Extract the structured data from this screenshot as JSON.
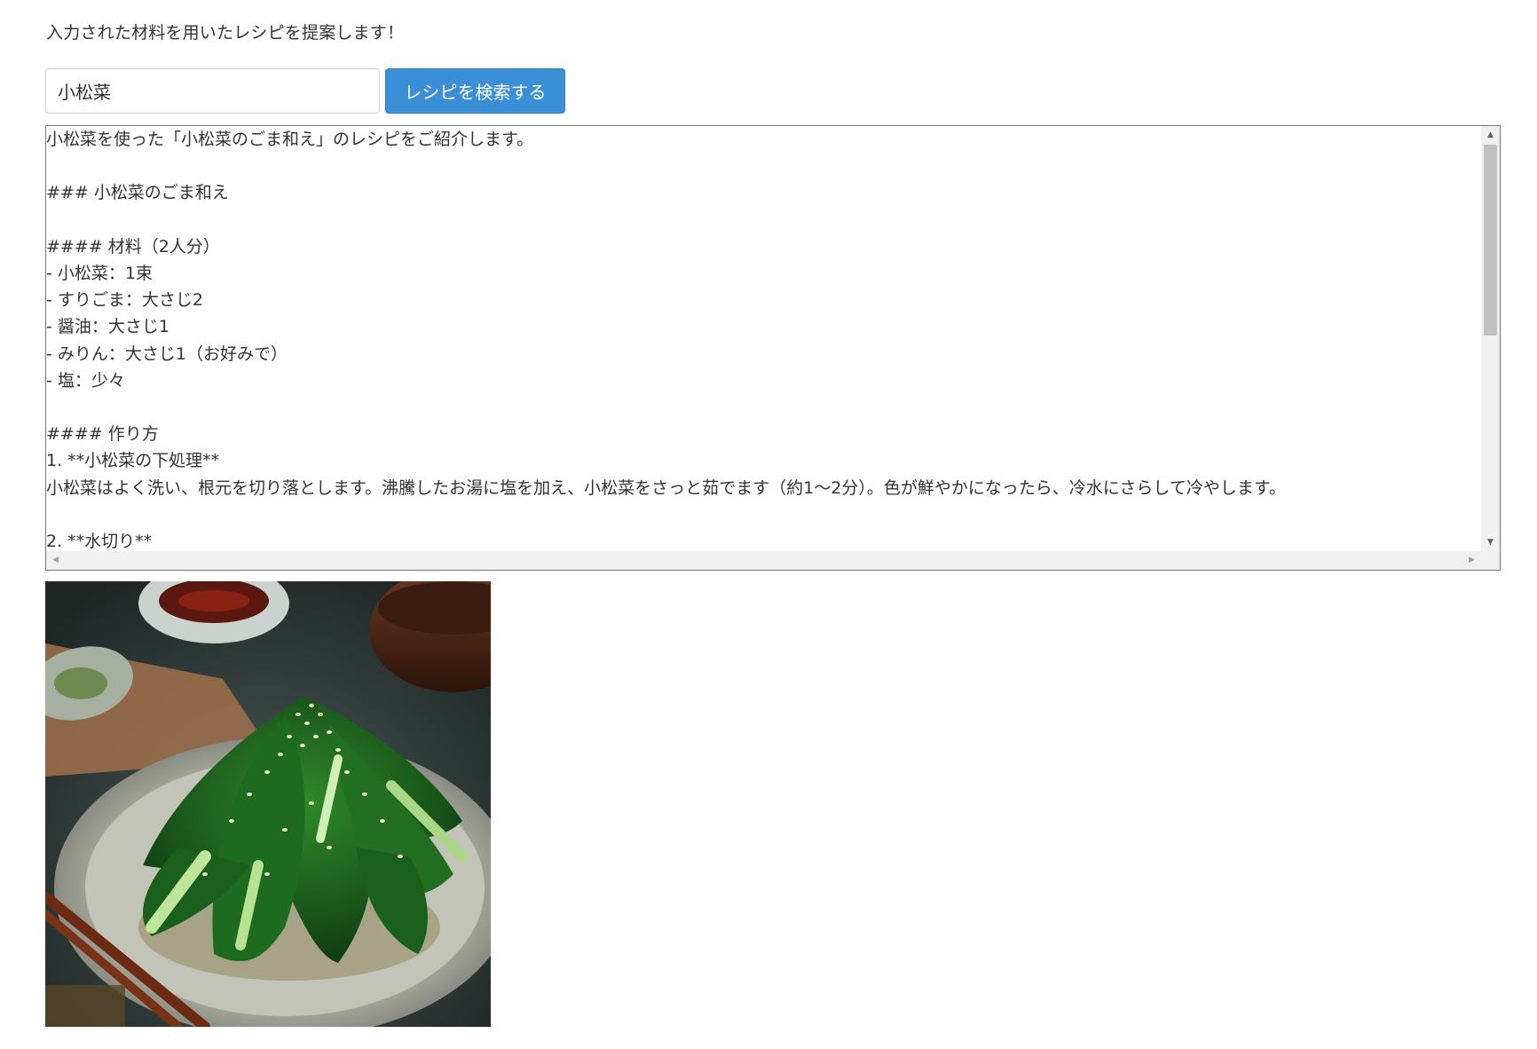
{
  "intro_text": "入力された材料を用いたレシピを提案します！",
  "search": {
    "value": "小松菜",
    "button_label": "レシピを検索する"
  },
  "result": {
    "text": "小松菜を使った「小松菜のごま和え」のレシピをご紹介します。\n\n### 小松菜のごま和え\n\n#### 材料（2人分）\n- 小松菜：1束\n- すりごま：大さじ2\n- 醤油：大さじ1\n- みりん：大さじ1（お好みで）\n- 塩：少々\n\n#### 作り方\n1. **小松菜の下処理**\n小松菜はよく洗い、根元を切り落とします。沸騰したお湯に塩を加え、小松菜をさっと茹でます（約1〜2分）。色が鮮やかになったら、冷水にさらして冷やします。\n\n2. **水切り**"
  },
  "scrollbar": {
    "up_arrow": "▲",
    "down_arrow": "▼",
    "left_arrow": "◀",
    "right_arrow": "▶"
  },
  "image": {
    "subject": "小松菜のごま和え dish photo",
    "icon": "food-photo"
  },
  "colors": {
    "button_bg": "#3a8fd6",
    "button_text": "#ffffff",
    "text": "#333333"
  }
}
